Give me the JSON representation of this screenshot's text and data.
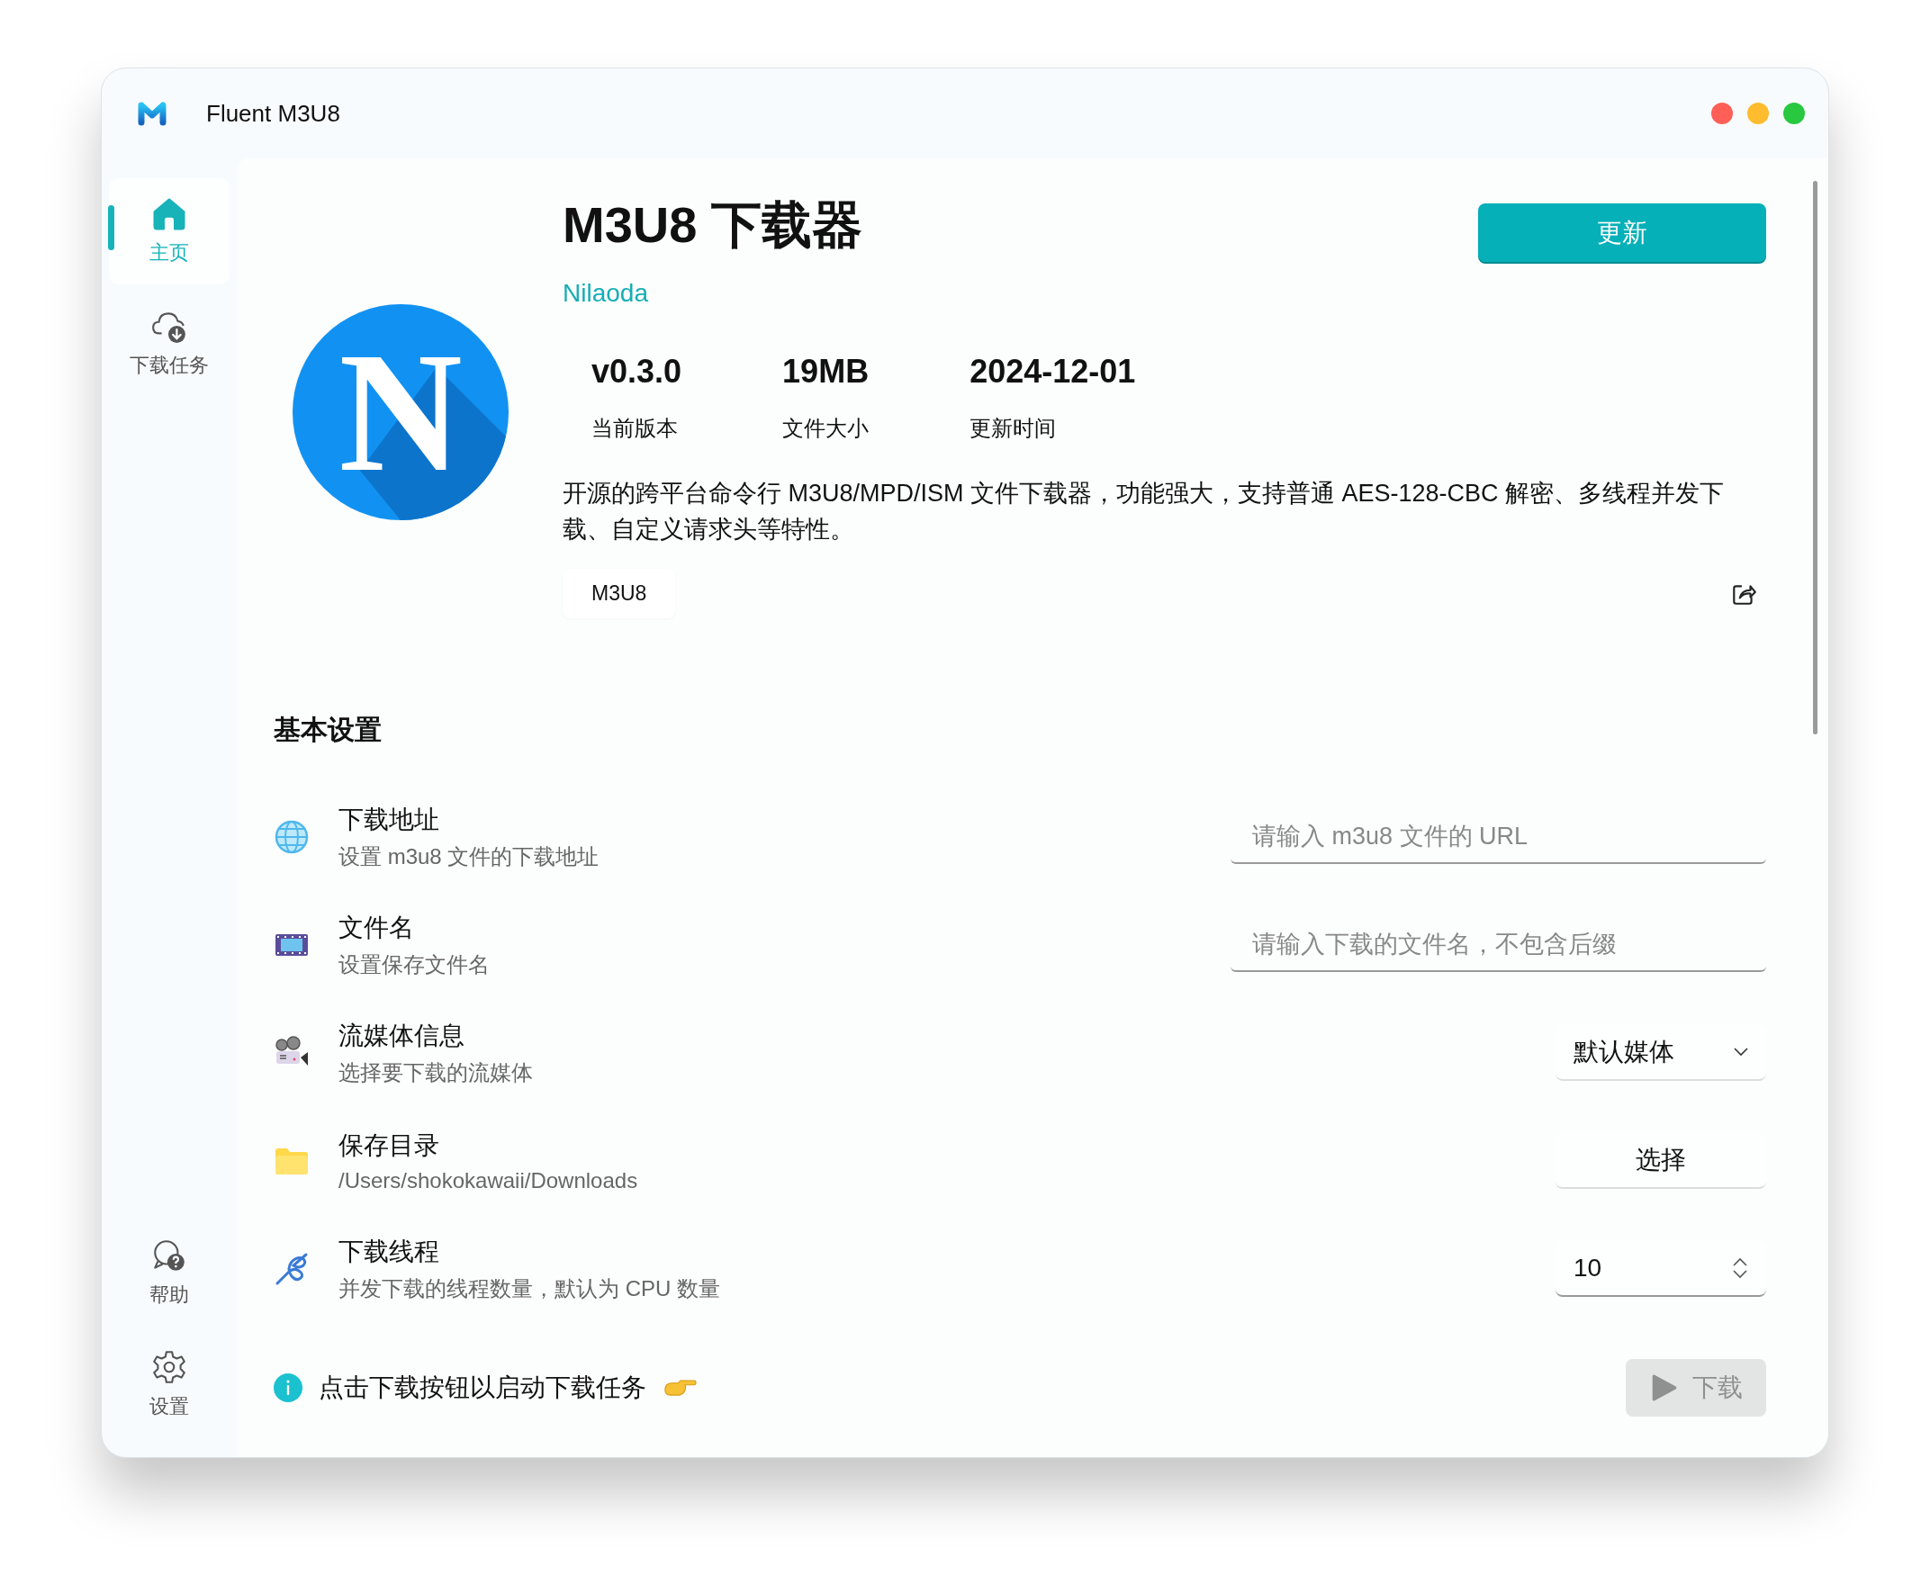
{
  "window": {
    "title": "Fluent M3U8"
  },
  "sidebar": {
    "items": [
      {
        "label": "主页",
        "selected": true
      },
      {
        "label": "下载任务",
        "selected": false
      }
    ],
    "bottom_items": [
      {
        "label": "帮助",
        "selected": false
      },
      {
        "label": "设置",
        "selected": false
      }
    ]
  },
  "app": {
    "logo_letter": "N",
    "name": "M3U8 下载器",
    "author": "Nilaoda",
    "update_button": "更新",
    "stats": [
      {
        "value": "v0.3.0",
        "label": "当前版本"
      },
      {
        "value": "19MB",
        "label": "文件大小"
      },
      {
        "value": "2024-12-01",
        "label": "更新时间"
      }
    ],
    "description": "开源的跨平台命令行 M3U8/MPD/ISM 文件下载器，功能强大，支持普通 AES-128-CBC 解密、多线程并发下载、自定义请求头等特性。",
    "tags": [
      "M3U8"
    ]
  },
  "settings": {
    "title": "基本设置",
    "rows": [
      {
        "kind": "input",
        "title": "下载地址",
        "subtitle": "设置 m3u8 文件的下载地址",
        "placeholder": "请输入 m3u8 文件的 URL"
      },
      {
        "kind": "input",
        "title": "文件名",
        "subtitle": "设置保存文件名",
        "placeholder": "请输入下载的文件名，不包含后缀"
      },
      {
        "kind": "dropdown",
        "title": "流媒体信息",
        "subtitle": "选择要下载的流媒体",
        "value": "默认媒体"
      },
      {
        "kind": "button",
        "title": "保存目录",
        "subtitle": "/Users/shokokawaii/Downloads",
        "button": "选择"
      },
      {
        "kind": "spinner",
        "title": "下载线程",
        "subtitle": "并发下载的线程数量，默认为 CPU 数量",
        "value": "10"
      }
    ]
  },
  "footer": {
    "notice": "点击下载按钮以启动下载任务",
    "download_button": {
      "label": "下载",
      "disabled": true
    }
  }
}
